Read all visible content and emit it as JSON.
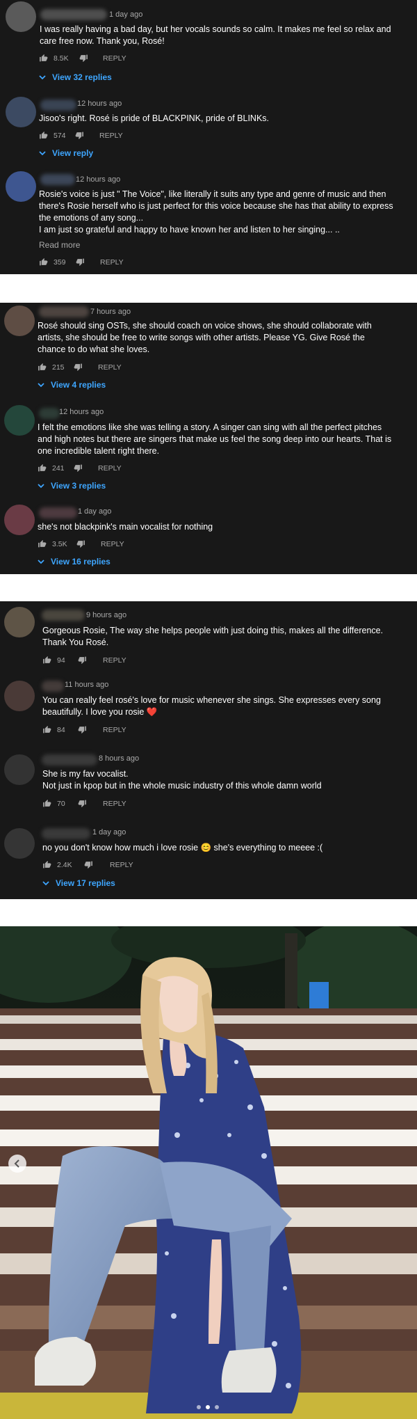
{
  "panels": [
    {
      "comments": [
        {
          "time": "1 day ago",
          "text": "I was really having a bad day, but her vocals sounds so calm. It makes me feel so relax and care free now. Thank you, Rosé!",
          "likes": "8.5K",
          "reply": "REPLY",
          "view_replies": "View 32 replies"
        },
        {
          "time": "12 hours ago",
          "text": "Jisoo's right. Rosé is pride of BLACKPINK, pride of BLINKs.",
          "likes": "574",
          "reply": "REPLY",
          "view_replies": "View reply"
        },
        {
          "time": "12 hours ago",
          "text": "Rosie's voice is just \" The Voice\", like literally it suits any type and genre of music and then there's Rosie herself who is just perfect for this voice because she has that ability to express the emotions of any song...\nI am just so grateful and happy to have known her and listen to her singing... ..",
          "read_more": "Read more",
          "likes": "359",
          "reply": "REPLY"
        }
      ]
    },
    {
      "comments": [
        {
          "time": "7 hours ago",
          "text": "Rosé should sing OSTs, she should coach on voice shows, she should collaborate with artists, she should be free to write songs with other artists. Please YG. Give Rosé the chance to do what she loves.",
          "likes": "215",
          "reply": "REPLY",
          "view_replies": "View 4 replies"
        },
        {
          "time": "12 hours ago",
          "text": "I felt the emotions like she was telling a story. A singer can sing with all the perfect pitches and high notes but there are singers that make us feel the song deep into our hearts. That is one incredible talent right there.",
          "likes": "241",
          "reply": "REPLY",
          "view_replies": "View 3 replies"
        },
        {
          "time": "1 day ago",
          "text": "she's not blackpink's main vocalist for nothing",
          "likes": "3.5K",
          "reply": "REPLY",
          "view_replies": "View 16 replies"
        }
      ]
    },
    {
      "comments": [
        {
          "time": "9 hours ago",
          "text": "Gorgeous Rosie, The way she helps people with just doing this, makes all the difference. Thank You Rosé.",
          "likes": "94",
          "reply": "REPLY"
        },
        {
          "time": "11 hours ago",
          "text": "You can really feel rosé's love for music whenever she sings. She expresses every song beautifully. I love you rosie ❤️",
          "likes": "84",
          "reply": "REPLY"
        },
        {
          "time": "8 hours ago",
          "text": "She is my fav vocalist.\nNot just in kpop but in the whole music industry of this whole damn world",
          "likes": "70",
          "reply": "REPLY"
        },
        {
          "time": "1 day ago",
          "text": "no you don't know how much i love rosie 😊 she's everything to meeee :(",
          "likes": "2.4K",
          "reply": "REPLY",
          "view_replies": "View 17 replies"
        }
      ]
    }
  ],
  "icons": {
    "like": "thumbs-up-icon",
    "dislike": "thumbs-down-icon",
    "expand": "chevron-down-icon",
    "carousel_prev": "chevron-left-icon"
  },
  "colors": {
    "panel_bg": "#181818",
    "link_blue": "#3ea6ff",
    "meta_gray": "#aaaaaa",
    "text_white": "#ffffff"
  },
  "carousel": {
    "slide_count": 3,
    "active_index": 1
  }
}
